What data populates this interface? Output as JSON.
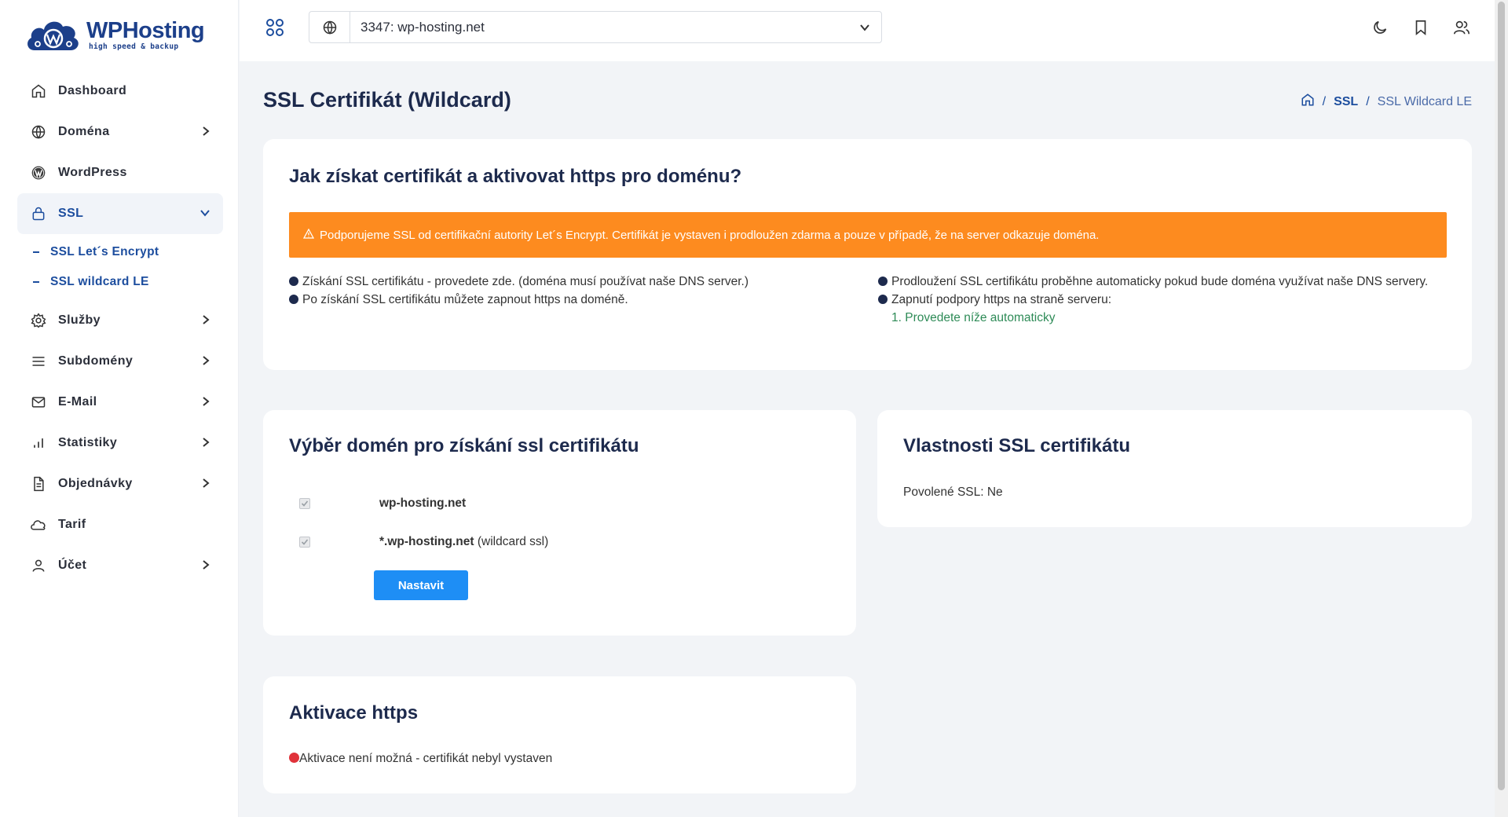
{
  "brand": {
    "name": "WPHosting",
    "tagline": "high speed & backup",
    "color": "#1c3f8a"
  },
  "sidebar": {
    "items": [
      {
        "label": "Dashboard",
        "icon": "home-icon",
        "has_children": false
      },
      {
        "label": "Doména",
        "icon": "globe-icon",
        "has_children": true
      },
      {
        "label": "WordPress",
        "icon": "wordpress-icon",
        "has_children": false
      },
      {
        "label": "SSL",
        "icon": "lock-icon",
        "has_children": true,
        "expanded": true
      },
      {
        "label": "Služby",
        "icon": "gear-icon",
        "has_children": true
      },
      {
        "label": "Subdomény",
        "icon": "menu-icon",
        "has_children": true
      },
      {
        "label": "E-Mail",
        "icon": "mail-icon",
        "has_children": true
      },
      {
        "label": "Statistiky",
        "icon": "bar-chart-icon",
        "has_children": true
      },
      {
        "label": "Objednávky",
        "icon": "document-icon",
        "has_children": true
      },
      {
        "label": "Tarif",
        "icon": "cloud-icon",
        "has_children": false
      },
      {
        "label": "Účet",
        "icon": "user-icon",
        "has_children": true
      }
    ],
    "ssl_subitems": [
      {
        "label": "SSL Let´s Encrypt"
      },
      {
        "label": "SSL wildcard LE"
      }
    ]
  },
  "header": {
    "domain_select": "3347: wp-hosting.net",
    "icons": [
      "apps-grid-icon",
      "globe-icon",
      "chevron-down-icon",
      "moon-icon",
      "bookmark-icon",
      "users-icon"
    ]
  },
  "page": {
    "title": "SSL Certifikát (Wildcard)",
    "breadcrumb": {
      "home_icon": "home-icon",
      "sep": "/",
      "ssl": "SSL",
      "current": "SSL Wildcard LE"
    }
  },
  "info_card": {
    "title": "Jak získat certifikát a aktivovat https pro doménu?",
    "alert": "Podporujeme SSL od certifikační autority Let´s Encrypt. Certifikát je vystaven i prodloužen zdarma a pouze v případě, že na server odkazuje doména.",
    "alert_color": "#fd8b1f",
    "left": [
      "Získání SSL certifikátu - provedete zde. (doména musí používat naše DNS server.)",
      "Po získání SSL certifikátu můžete zapnout https na doméně."
    ],
    "right": [
      "Prodloužení SSL certifikátu proběhne automaticky pokud bude doména využívat naše DNS servery.",
      "Zapnutí podpory https na straně serveru:"
    ],
    "right_step": "1. Provedete níže automaticky"
  },
  "domain_card": {
    "title": "Výběr domén pro získání ssl certifikátu",
    "domains": [
      {
        "name": "wp-hosting.net",
        "suffix": "",
        "checked": true
      },
      {
        "name": "*.wp-hosting.net",
        "suffix": " (wildcard ssl)",
        "checked": true
      }
    ],
    "button": "Nastavit",
    "button_color": "#1e8ef5"
  },
  "props_card": {
    "title": "Vlastnosti SSL certifikátu",
    "enabled_label": "Povolené SSL: Ne"
  },
  "https_card": {
    "title": "Aktivace https",
    "status": "Aktivace není možná - certifikát nebyl vystaven",
    "status_color": "#e0323a"
  }
}
